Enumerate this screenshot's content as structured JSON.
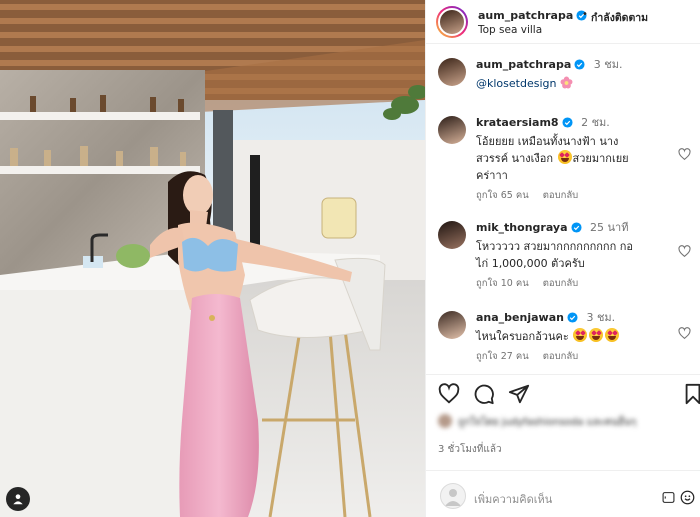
{
  "header": {
    "username": "aum_patchrapa",
    "separator": "•",
    "follow_label": "กำลังติดตาม",
    "location": "Top sea villa"
  },
  "caption": {
    "username": "aum_patchrapa",
    "time": "3 ชม.",
    "mention": "@klosetdesign"
  },
  "comments": [
    {
      "username": "krataersiam8",
      "time": "2 ชม.",
      "text_parts": [
        "โอ้ยยยย เหมือนทั้งนางฟ้า นาง",
        "สวรรค์ นางเงือก",
        "สวยมากเยย",
        "คร่าาา"
      ],
      "likes": "ถูกใจ 65 คน",
      "reply": "ตอบกลับ"
    },
    {
      "username": "mik_thongraya",
      "time": "25 นาที",
      "text_parts": [
        "โหววววว สวยมากกกกกกกกก กอ",
        "ไก่ 1,000,000 ตัวครับ"
      ],
      "likes": "ถูกใจ 10 คน",
      "reply": "ตอบกลับ"
    },
    {
      "username": "ana_benjawan",
      "time": "3 ชม.",
      "text_parts": [
        "ไหนใครบอกอ้วนคะ"
      ],
      "likes": "ถูกใจ 27 คน",
      "reply": "ตอบกลับ"
    }
  ],
  "actions": {
    "icons": [
      "heart-icon",
      "comment-icon",
      "share-icon",
      "bookmark-icon"
    ]
  },
  "liked_by_blurred": "ถูกใจโดย judyfashionsoda และคนอื่นๆ",
  "timestamp": "3 ชั่วโมงที่แล้ว",
  "add_comment": {
    "placeholder": "เพิ่มความคิดเห็น"
  },
  "colors": {
    "verified": "#0095f6",
    "link": "#00376b",
    "muted": "#737373"
  }
}
